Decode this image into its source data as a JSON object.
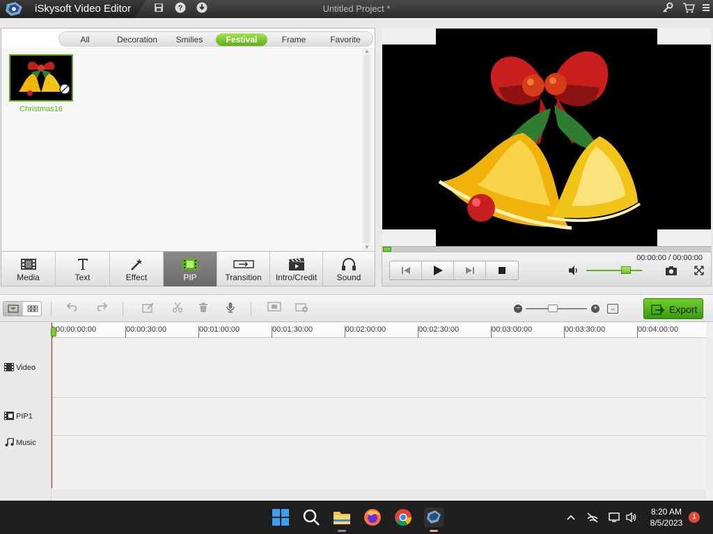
{
  "app": {
    "name": "iSkysoft Video Editor",
    "project_title": "Untitled Project *"
  },
  "library": {
    "categories": [
      {
        "label": "All",
        "active": false
      },
      {
        "label": "Decoration",
        "active": false
      },
      {
        "label": "Smilies",
        "active": false
      },
      {
        "label": "Festival",
        "active": true
      },
      {
        "label": "Frame",
        "active": false
      },
      {
        "label": "Favorite",
        "active": false
      }
    ],
    "items": [
      {
        "label": "Christmas16"
      }
    ],
    "tabs": [
      {
        "label": "Media",
        "icon": "film-icon",
        "active": false
      },
      {
        "label": "Text",
        "icon": "text-icon",
        "active": false
      },
      {
        "label": "Effect",
        "icon": "magic-wand-icon",
        "active": false
      },
      {
        "label": "PIP",
        "icon": "pip-icon",
        "active": true
      },
      {
        "label": "Transition",
        "icon": "transition-icon",
        "active": false
      },
      {
        "label": "Intro/Credit",
        "icon": "clapperboard-icon",
        "active": false
      },
      {
        "label": "Sound",
        "icon": "headphones-icon",
        "active": false
      }
    ]
  },
  "preview": {
    "timecode": "00:00:00 / 00:00:00",
    "volume_level": 0.72
  },
  "toolbar": {
    "export_label": "Export"
  },
  "timeline": {
    "ruler_ticks": [
      "00:00:00:00",
      "00:00:30:00",
      "00:01:00:00",
      "00:01:30:00",
      "00:02:00:00",
      "00:02:30:00",
      "00:03:00:00",
      "00:03:30:00",
      "00:04:00:00"
    ],
    "tracks": [
      {
        "label": "Video",
        "icon": "video-track-icon"
      },
      {
        "label": "PIP1",
        "icon": "pip-track-icon"
      },
      {
        "label": "Music",
        "icon": "music-note-icon"
      }
    ]
  },
  "taskbar": {
    "time": "8:20 AM",
    "date": "8/5/2023",
    "notification_count": "1"
  },
  "colors": {
    "accent_green": "#5fae1c",
    "playhead_red": "#dd2222"
  }
}
